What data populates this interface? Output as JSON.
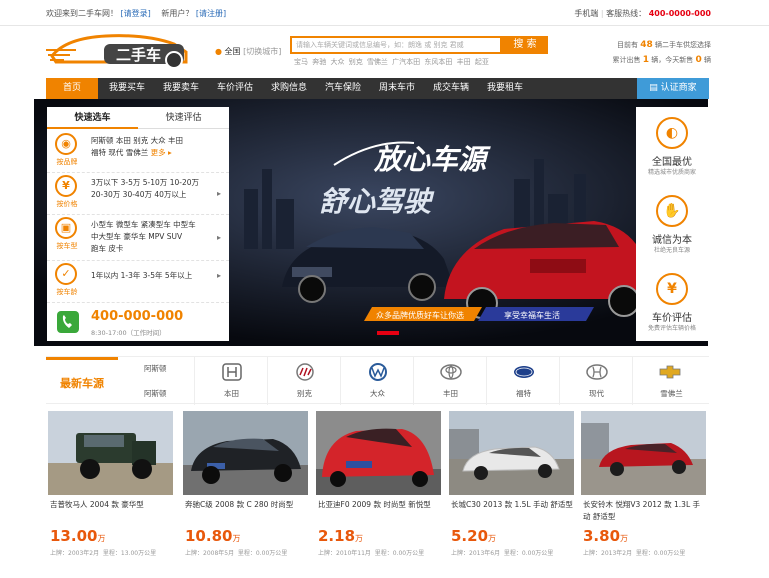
{
  "topbar": {
    "welcome": "欢迎来到二手车网！",
    "login": "[请登录]",
    "new_user": "新用户？",
    "register": "[请注册]",
    "mobile": "手机端",
    "hotline_label": "客服热线：",
    "hotline": "400-0000-000"
  },
  "header": {
    "logo_text": "二手车",
    "city": "全国",
    "switch_city": "[切换城市]",
    "search_placeholder": "请输入车辆关键词或信息编号，如：朗逸 或 别克 君威",
    "search_button": "搜 索",
    "hot_words": [
      "宝马",
      "奔驰",
      "大众",
      "别克",
      "雪佛兰",
      "广汽本田",
      "东风本田",
      "丰田",
      "起亚"
    ],
    "stats_line1_pre": "目前有",
    "stats_line1_num": "48",
    "stats_line1_post": "辆二手车供您选择",
    "stats_line2_pre": "累计出售",
    "stats_line2_num": "1",
    "stats_line2_mid": "辆，今天新售",
    "stats_line2_num2": "0",
    "stats_line2_post": "辆"
  },
  "nav": {
    "items": [
      "首页",
      "我要买车",
      "我要卖车",
      "车价评估",
      "求购信息",
      "汽车保险",
      "周末车市",
      "成交车辆",
      "我要租车"
    ],
    "cert": "认证商家"
  },
  "banner": {
    "slogan1": "放心车源",
    "slogan2": "舒心驾驶",
    "tag1": "众多品牌优质好车让你选",
    "tag2": "享受幸福车生活"
  },
  "quick": {
    "tab_car": "快速选车",
    "tab_eval": "快速评估",
    "rows": [
      {
        "icon": "◉",
        "label": "按品牌",
        "line1": "阿斯顿  本田  别克  大众  丰田",
        "line2": "福特  现代  雪佛兰",
        "more": "更多"
      },
      {
        "icon": "¥",
        "label": "按价格",
        "line1": "3万以下  3-5万  5-10万  10-20万",
        "line2": "20-30万  30-40万  40万以上",
        "more": ""
      },
      {
        "icon": "▣",
        "label": "按车型",
        "line1": "小型车  微型车  紧凑型车  中型车",
        "line2": "中大型车  豪华车  MPV  SUV",
        "line3": "跑车  皮卡"
      },
      {
        "icon": "✓",
        "label": "按车龄",
        "line1": "1年以内  1-3年  3-5年  5年以上",
        "line2": ""
      }
    ],
    "phone": "400-000-000",
    "phone_hours": "8:30-17:00（工作时间）"
  },
  "features": [
    {
      "icon": "◐",
      "title": "全国最优",
      "sub": "精选城市优质商家"
    },
    {
      "icon": "✋",
      "title": "诚信为本",
      "sub": "杜绝无良车源"
    },
    {
      "icon": "¥",
      "title": "车价评估",
      "sub": "免费评估车辆价格"
    }
  ],
  "brandbar": {
    "title": "最新车源",
    "sub1": "阿斯顿",
    "sub2": "阿斯顿",
    "brands": [
      {
        "name": "本田",
        "icon": "honda-logo-icon"
      },
      {
        "name": "别克",
        "icon": "buick-logo-icon"
      },
      {
        "name": "大众",
        "icon": "vw-logo-icon"
      },
      {
        "name": "丰田",
        "icon": "toyota-logo-icon"
      },
      {
        "name": "福特",
        "icon": "ford-logo-icon"
      },
      {
        "name": "现代",
        "icon": "hyundai-logo-icon"
      },
      {
        "name": "雪佛兰",
        "icon": "chevrolet-logo-icon"
      }
    ]
  },
  "cars": [
    {
      "title": "吉普牧马人 2004 款 豪华型",
      "price": "13.00",
      "unit": "万",
      "reg": "上牌：2003年2月",
      "km": "里程：13.00万公里",
      "color": "#2b3b2e"
    },
    {
      "title": "奔驰C级 2008 款 C 280 时尚型",
      "price": "10.80",
      "unit": "万",
      "reg": "上牌：2008年5月",
      "km": "里程：0.00万公里",
      "color": "#1f2226"
    },
    {
      "title": "比亚迪F0 2009 款 时尚型 新悦型",
      "price": "2.18",
      "unit": "万",
      "reg": "上牌：2010年11月",
      "km": "里程：0.00万公里",
      "color": "#d4242a"
    },
    {
      "title": "长城C30 2013 款 1.5L 手动 舒适型",
      "price": "5.20",
      "unit": "万",
      "reg": "上牌：2013年6月",
      "km": "里程：0.00万公里",
      "color": "#e8e8e8"
    },
    {
      "title": "长安铃木 悦翔V3 2012 款 1.3L 手动 舒适型",
      "price": "3.80",
      "unit": "万",
      "reg": "上牌：2013年2月",
      "km": "里程：0.00万公里",
      "color": "#b8161f"
    }
  ],
  "colors": {
    "accent": "#f08300",
    "nav_bg": "#333333",
    "cert_bg": "#3f9bd8",
    "price": "#e8580c"
  }
}
